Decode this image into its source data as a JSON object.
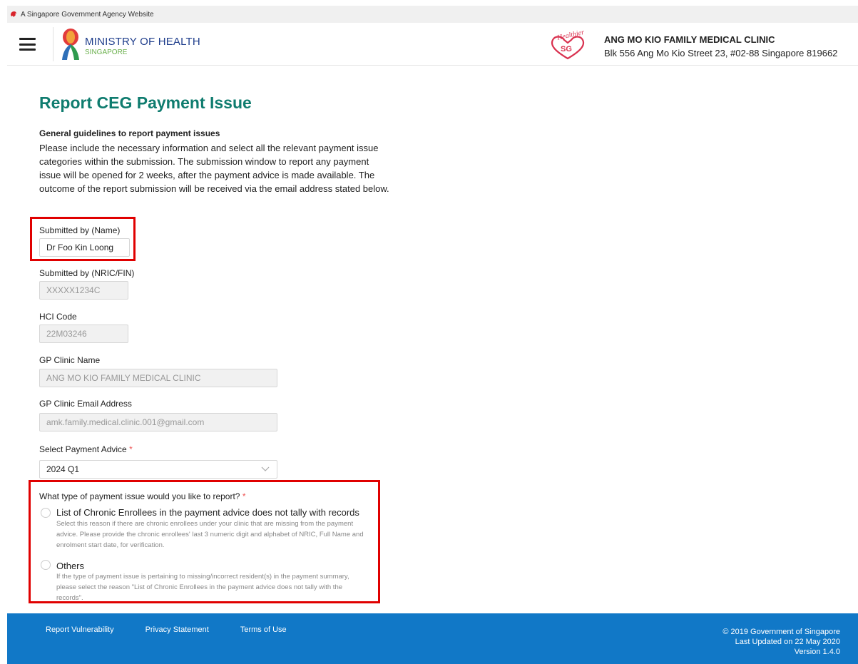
{
  "masthead": {
    "text": "A Singapore Government Agency Website"
  },
  "header": {
    "ministry_line1": "MINISTRY OF HEALTH",
    "ministry_line2": "SINGAPORE",
    "clinic_name": "ANG MO KIO FAMILY MEDICAL CLINIC",
    "clinic_address": "Blk 556 Ang Mo Kio Street 23, #02-88 Singapore 819662",
    "hsg_logo_text": "Healthier SG"
  },
  "main": {
    "title": "Report CEG Payment Issue",
    "guidelines_title": "General guidelines to report payment issues",
    "guidelines_text": "Please include the necessary information and select all the relevant payment issue categories within the submission. The submission window to report any payment issue will be opened for 2 weeks, after the payment advice is made available. The outcome of the report submission will be received via the email address stated below.",
    "fields": {
      "name": {
        "label": "Submitted by (Name)",
        "value": "Dr Foo Kin Loong"
      },
      "nric": {
        "label": "Submitted by (NRIC/FIN)",
        "value": "XXXXX1234C"
      },
      "hci": {
        "label": "HCI Code",
        "value": "22M03246"
      },
      "clinic_name": {
        "label": "GP Clinic Name",
        "value": "ANG MO KIO FAMILY MEDICAL CLINIC"
      },
      "clinic_email": {
        "label": "GP Clinic Email Address",
        "value": "amk.family.medical.clinic.001@gmail.com"
      },
      "payment_advice": {
        "label": "Select Payment Advice",
        "required_mark": "*",
        "value": "2024 Q1"
      }
    },
    "issue_question": {
      "label": "What type of payment issue would you like to report?",
      "required_mark": "*"
    },
    "issue_options": [
      {
        "title": "List of Chronic Enrollees in the payment advice does not tally with records",
        "desc_line1": "Select this reason if there are chronic enrollees under your clinic that are missing from the payment",
        "desc_line2": "advice. Please provide the chronic enrollees' last 3 numeric digit and alphabet of NRIC, Full Name and",
        "desc_line3": "enrolment start date, for verification."
      },
      {
        "title": "Others",
        "desc_line1": "If the type of payment issue is pertaining to missing/incorrect resident(s) in the payment summary,",
        "desc_line2": "please select the reason \"List of Chronic Enrollees in the payment advice does not tally with the",
        "desc_line3": "records\"."
      }
    ]
  },
  "footer": {
    "links": [
      "Report Vulnerability",
      "Privacy Statement",
      "Terms of Use"
    ],
    "copyright": "© 2019 Government of Singapore",
    "updated": "Last Updated on 22 May 2020",
    "version": "Version 1.4.0"
  },
  "colors": {
    "title_teal": "#0f7c6f",
    "ministry_blue": "#1f3e8c",
    "footer_blue": "#1178c7",
    "highlight_red": "#e00000"
  }
}
